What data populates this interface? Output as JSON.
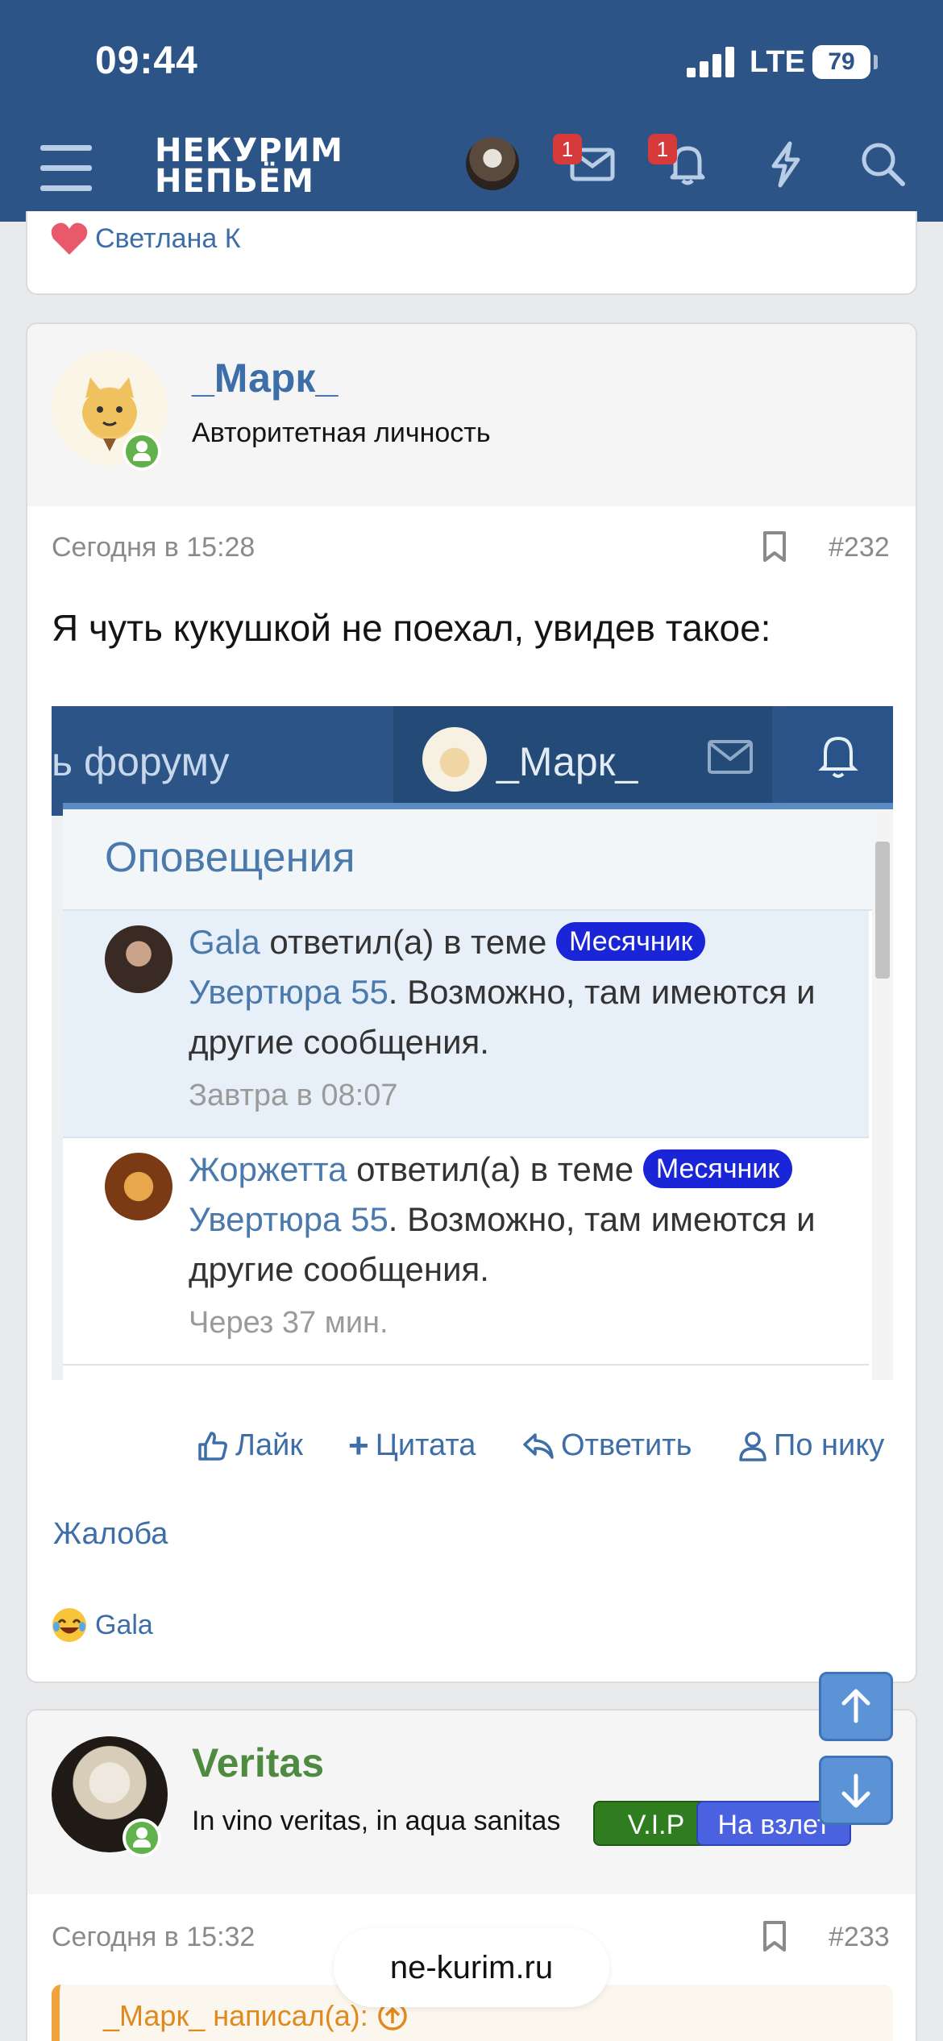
{
  "status_bar": {
    "time": "09:44",
    "network": "LTE",
    "battery": "79"
  },
  "header": {
    "logo_line1": "НЕКУРИМ",
    "logo_line2": "НЕПЬЁМ",
    "messages_badge": "1",
    "alerts_badge": "1"
  },
  "prev_post": {
    "like_user": "Светлана К"
  },
  "post1": {
    "username": "_Марк_",
    "user_title": "Авторитетная личность",
    "date": "Сегодня в 15:28",
    "number": "#232",
    "text": "Я чуть кукушкой не поехал, увидев такое:",
    "screenshot": {
      "forum_text": "ь форуму",
      "user": "_Марк_",
      "panel_title": "Оповещения",
      "notifications": [
        {
          "author": "Gala",
          "action": " ответил(а) в теме ",
          "tag": "Месячник",
          "thread": "Увертюра 55",
          "rest": ". Возможно, там имеются и другие сообщения.",
          "time": "Завтра в 08:07"
        },
        {
          "author": "Жоржетта",
          "action": " ответил(а) в теме ",
          "tag": "Месячник",
          "thread": " Увертюра 55",
          "rest": ". Возможно, там имеются и другие сообщения.",
          "time": "Через 37 мин."
        }
      ]
    },
    "actions": {
      "like": "Лайк",
      "quote": "Цитата",
      "reply": "Ответить",
      "by_nick": "По нику"
    },
    "report": "Жалоба",
    "reaction_user": "Gala"
  },
  "post2": {
    "username": "Veritas",
    "user_title": "In vino veritas, in aqua sanitas",
    "tag_vip": "V.I.P",
    "tag_rank": "На взлет",
    "date": "Сегодня в 15:32",
    "number": "#233",
    "quote_header": "_Марк_ написал(а):"
  },
  "url_bar": {
    "domain": "ne-kurim.ru"
  },
  "colors": {
    "header": "#2c5487",
    "link": "#3d6ea8",
    "online": "#63b14c",
    "tag_blue": "#1b25d8",
    "vip": "#2f7d1e",
    "rank": "#4b62e0",
    "quote_accent": "#f0a33c"
  },
  "icons": [
    "menu-icon",
    "envelope-icon",
    "bell-icon",
    "bolt-icon",
    "search-icon",
    "bookmark-icon",
    "thumbs-up-icon",
    "plus-icon",
    "reply-icon",
    "user-icon",
    "arrow-up-icon",
    "arrow-down-icon",
    "heart-icon",
    "laugh-emoji-icon"
  ]
}
